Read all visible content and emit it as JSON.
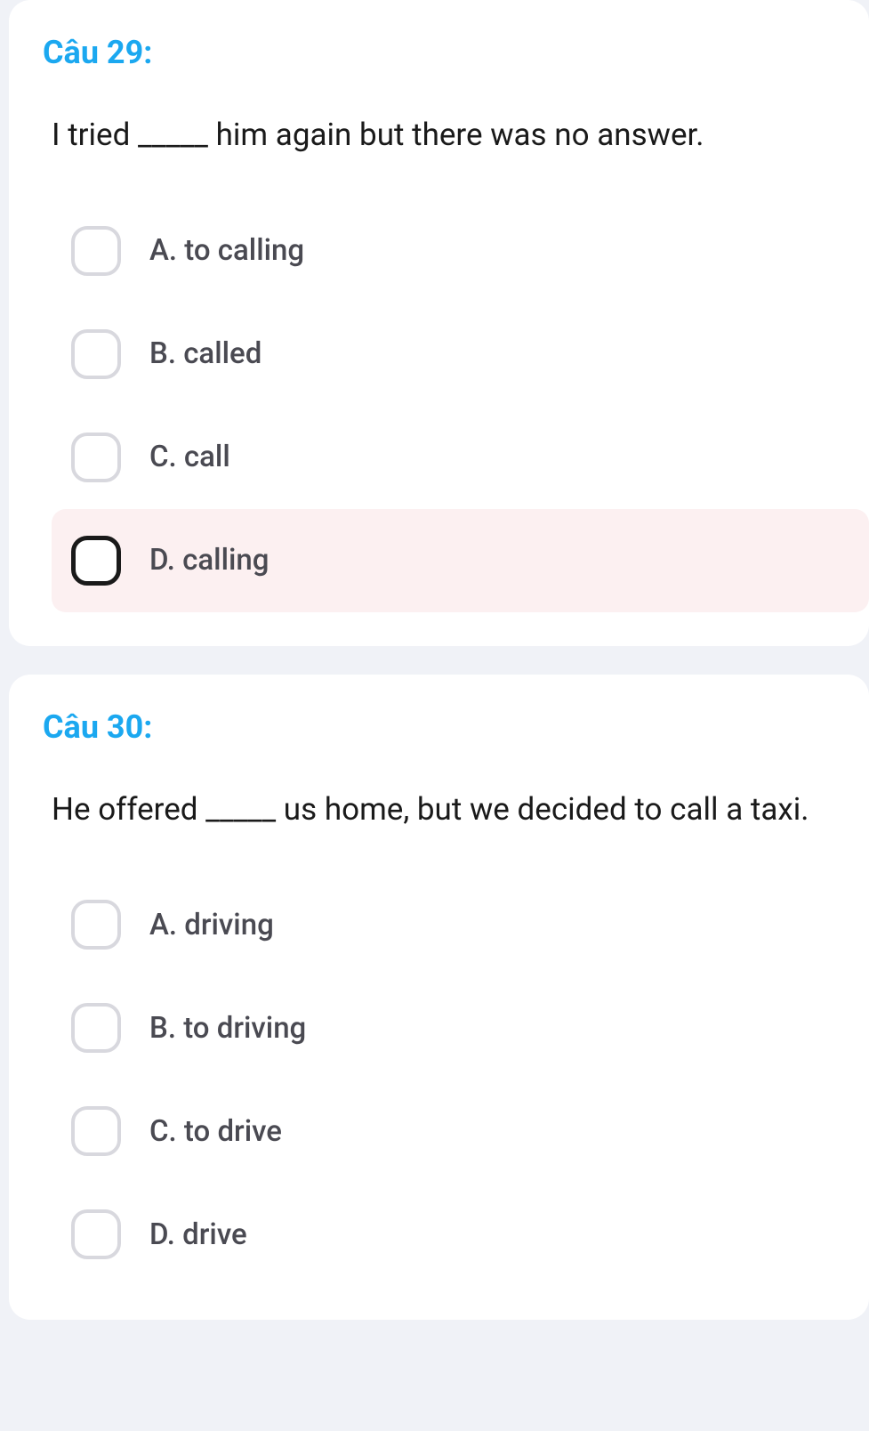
{
  "questions": [
    {
      "title": "Câu 29:",
      "text": "I tried _____ him again but there was no answer.",
      "options": [
        {
          "label": "A. to calling",
          "highlighted": false
        },
        {
          "label": "B. called",
          "highlighted": false
        },
        {
          "label": "C. call",
          "highlighted": false
        },
        {
          "label": "D. calling",
          "highlighted": true
        }
      ]
    },
    {
      "title": "Câu 30:",
      "text": "He offered _____ us home, but we decided to call a taxi.",
      "options": [
        {
          "label": "A. driving",
          "highlighted": false
        },
        {
          "label": "B. to driving",
          "highlighted": false
        },
        {
          "label": "C. to drive",
          "highlighted": false
        },
        {
          "label": "D. drive",
          "highlighted": false
        }
      ]
    }
  ]
}
